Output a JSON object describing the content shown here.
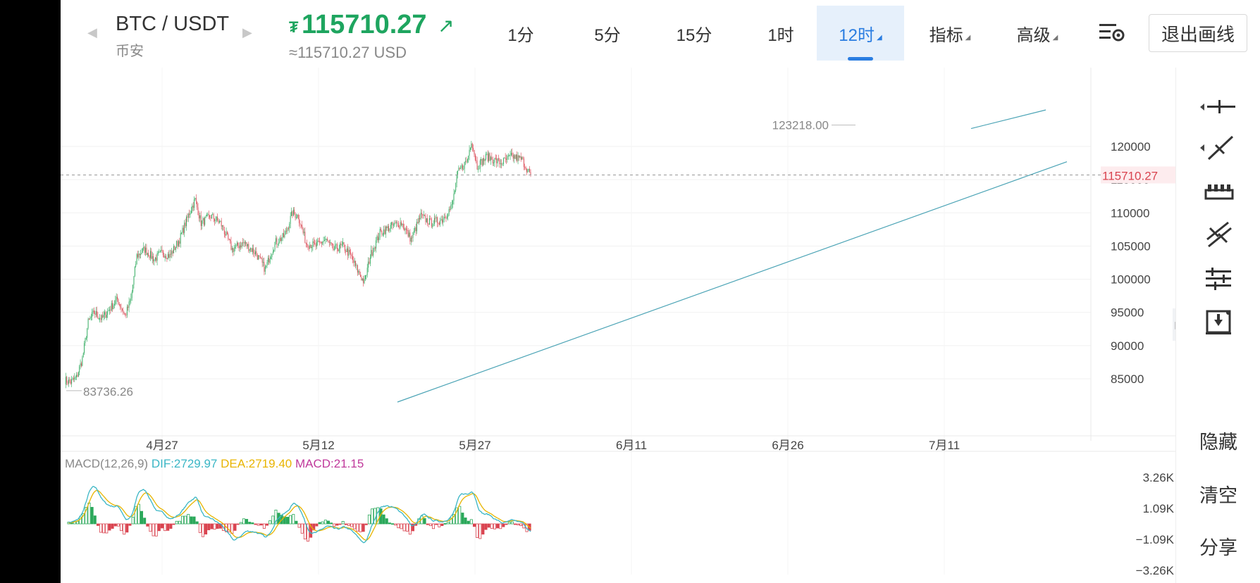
{
  "header": {
    "pair": "BTC / USDT",
    "exchange": "币安",
    "price_icon": "₮",
    "price": "115710.27",
    "price_trend": "↗",
    "usd_price": "≈115710.27 USD",
    "timeframes": [
      {
        "label": "1分"
      },
      {
        "label": "5分"
      },
      {
        "label": "15分"
      },
      {
        "label": "1时"
      },
      {
        "label": "12时",
        "active": true
      },
      {
        "label": "指标"
      },
      {
        "label": "高级"
      }
    ],
    "exit_button": "退出画线"
  },
  "chart": {
    "high_label": "123218.00",
    "low_label": "83736.26",
    "current_price_label": "115710.27",
    "y_ticks": [
      "120000",
      "115000",
      "110000",
      "105000",
      "100000",
      "95000",
      "90000",
      "85000"
    ],
    "x_ticks": [
      "4月27",
      "5月12",
      "5月27",
      "6月11",
      "6月26",
      "7月11"
    ],
    "macd_legend": {
      "name": "MACD(12,26,9)",
      "dif": "DIF:2729.97",
      "dea": "DEA:2719.40",
      "macd": "MACD:21.15"
    },
    "macd_ticks": [
      "3.26K",
      "1.09K",
      "−1.09K",
      "−3.26K"
    ]
  },
  "toolbar": {
    "tools": [
      "horizontal-line-tool-icon",
      "trend-line-tool-icon",
      "ruler-tool-icon",
      "parallel-channel-tool-icon",
      "horizontal-lines-tool-icon",
      "download-icon"
    ],
    "hide": "隐藏",
    "clear": "清空",
    "share": "分享"
  },
  "colors": {
    "up": "#2aa85a",
    "down": "#d9434f",
    "accent": "#2a7de1",
    "trend_line": "#4aa3b5",
    "dif": "#3ab6c5",
    "dea": "#e8b400",
    "macd": "#c0399b"
  }
}
